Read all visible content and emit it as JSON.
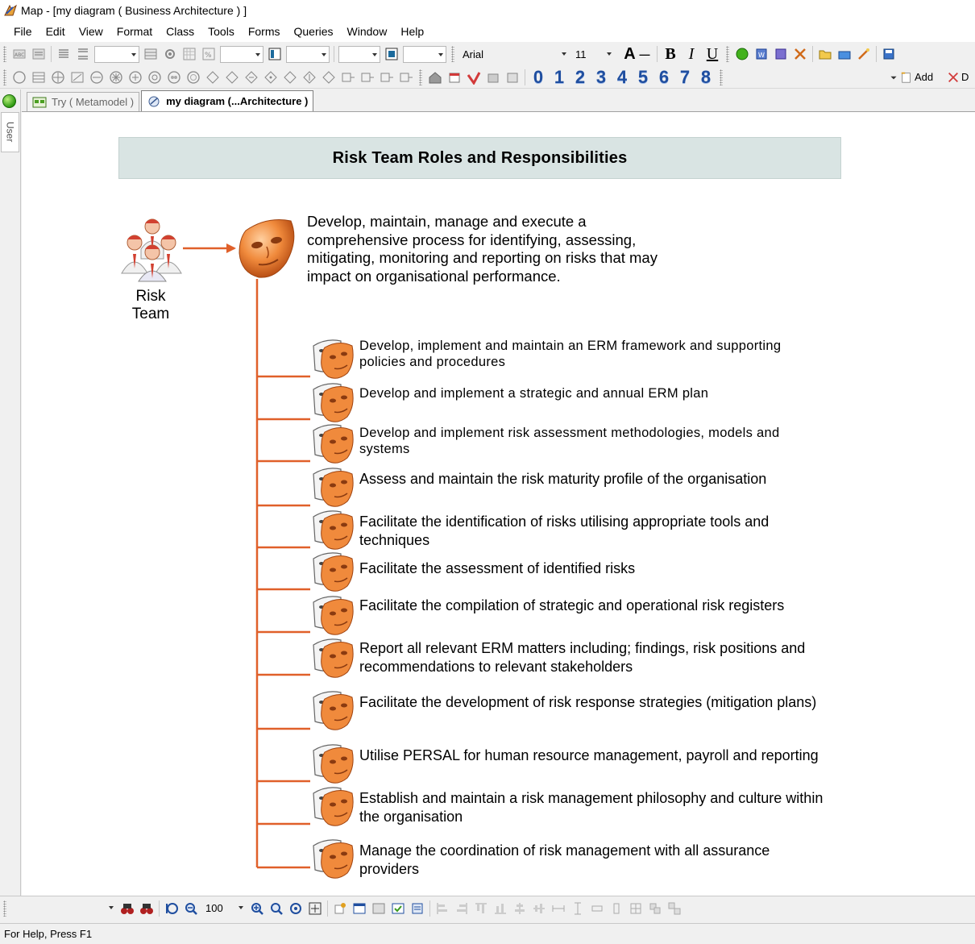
{
  "window": {
    "title": "Map - [my diagram ( Business Architecture ) ]"
  },
  "menu": {
    "items": [
      "File",
      "Edit",
      "View",
      "Format",
      "Class",
      "Tools",
      "Forms",
      "Queries",
      "Window",
      "Help"
    ]
  },
  "toolbar": {
    "font_name": "Arial",
    "font_size": "11",
    "bold_label": "B",
    "italic_label": "I",
    "underline_label": "U",
    "font_color_label": "A",
    "digits": [
      "0",
      "1",
      "2",
      "3",
      "4",
      "5",
      "6",
      "7",
      "8"
    ],
    "add_label": "Add",
    "delete_label": "D"
  },
  "sidebar": {
    "user_tab_label": "User"
  },
  "tabs": [
    {
      "label": "Try ( Metamodel )",
      "active": false
    },
    {
      "label": "my diagram (...Architecture )",
      "active": true
    }
  ],
  "diagram": {
    "title": "Risk Team Roles and Responsibilities",
    "actor_label_line1": "Risk",
    "actor_label_line2": "Team",
    "main_role": "Develop, maintain, manage and execute a comprehensive process for identifying, assessing, mitigating, monitoring and reporting on risks that may impact on organisational performance.",
    "responsibilities": [
      "Develop, implement and maintain an ERM framework and supporting policies and procedures",
      "Develop and implement a strategic and annual ERM plan",
      "Develop and implement risk assessment methodologies, models and systems",
      "Assess and maintain the risk maturity profile of the organisation",
      "Facilitate the identification of risks utilising appropriate tools and techniques",
      "Facilitate the assessment of identified risks",
      "Facilitate the compilation of strategic and operational risk registers",
      "Report all relevant ERM matters including; findings, risk positions and recommendations to relevant stakeholders",
      "Facilitate the development of risk response strategies (mitigation plans)",
      "Utilise PERSAL for human resource management, payroll and reporting",
      "Establish and maintain a risk management philosophy and culture within the organisation",
      "Manage the coordination of risk management with all assurance providers"
    ],
    "connector_color": "#e0602a"
  },
  "bottom_toolbar": {
    "zoom_value": "100"
  },
  "status": {
    "text": "For Help, Press F1"
  }
}
